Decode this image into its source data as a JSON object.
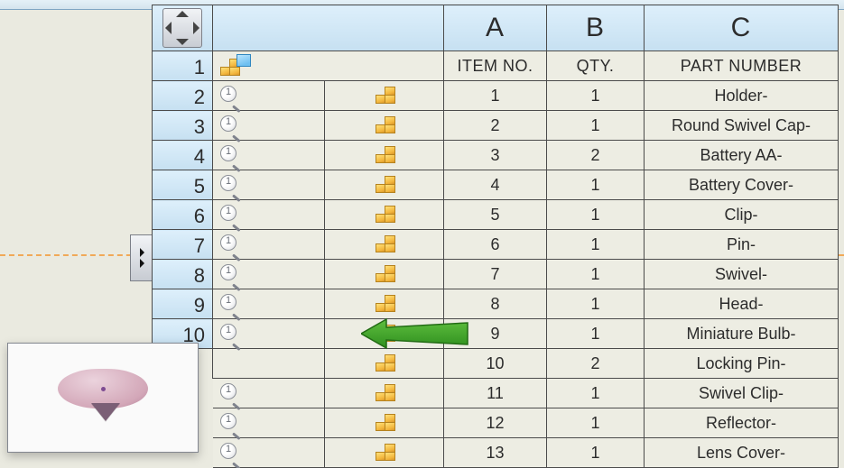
{
  "columns": {
    "A": "A",
    "B": "B",
    "C": "C"
  },
  "labels": {
    "A": "ITEM NO.",
    "B": "QTY.",
    "C": "PART NUMBER"
  },
  "row_numbers": [
    "1",
    "2",
    "3",
    "4",
    "5",
    "6",
    "7",
    "8",
    "9",
    "10"
  ],
  "rows": [
    {
      "item": "1",
      "qty": "1",
      "part": "Holder-"
    },
    {
      "item": "2",
      "qty": "1",
      "part": "Round Swivel Cap-"
    },
    {
      "item": "3",
      "qty": "2",
      "part": "Battery AA-"
    },
    {
      "item": "4",
      "qty": "1",
      "part": "Battery Cover-"
    },
    {
      "item": "5",
      "qty": "1",
      "part": "Clip-"
    },
    {
      "item": "6",
      "qty": "1",
      "part": "Pin-"
    },
    {
      "item": "7",
      "qty": "1",
      "part": "Swivel-"
    },
    {
      "item": "8",
      "qty": "1",
      "part": "Head-"
    },
    {
      "item": "9",
      "qty": "1",
      "part": "Miniature Bulb-"
    },
    {
      "item": "10",
      "qty": "2",
      "part": "Locking Pin-"
    },
    {
      "item": "11",
      "qty": "1",
      "part": "Swivel Clip-"
    },
    {
      "item": "12",
      "qty": "1",
      "part": "Reflector-"
    },
    {
      "item": "13",
      "qty": "1",
      "part": "Lens Cover-"
    }
  ],
  "mag_label": "1"
}
